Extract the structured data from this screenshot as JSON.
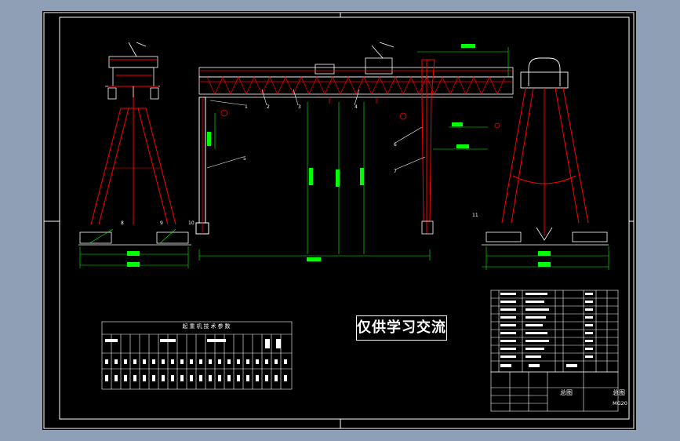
{
  "watermark": "仅供学习交流",
  "params_table": {
    "title": "起重机技术参数"
  },
  "title_block": {
    "drawing_name": "总图",
    "drawing_title": "总图",
    "drawing_code": "MG20"
  },
  "part_numbers": [
    "1",
    "2",
    "3",
    "4",
    "5",
    "6",
    "7",
    "8",
    "9",
    "10",
    "11"
  ],
  "colors": {
    "background": "#000000",
    "frame": "#ffffff",
    "structure": "#ff0000",
    "dimensions": "#00ff00",
    "rail_detail": "#ffffff"
  }
}
